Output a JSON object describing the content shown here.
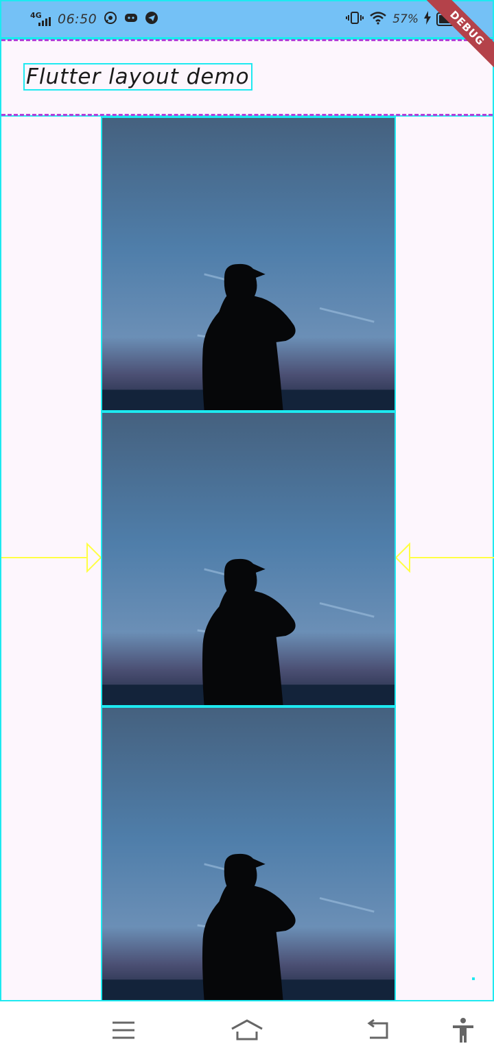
{
  "status_bar": {
    "network": "4G",
    "time": "06:50",
    "battery_percent": "57%",
    "battery_level": 0.57,
    "icons": [
      "whatsapp-icon",
      "discord-icon",
      "telegram-icon",
      "vibrate-icon",
      "wifi-icon",
      "charging-icon"
    ]
  },
  "debug_banner": {
    "label": "DEBUG",
    "color": "#b4424a"
  },
  "app_bar": {
    "title": "Flutter layout demo"
  },
  "main": {
    "images": [
      {
        "alt": "Silhouette of a man in a cap against a blue evening sky over the sea"
      },
      {
        "alt": "Silhouette of a man in a cap against a blue evening sky over the sea"
      },
      {
        "alt": "Silhouette of a man in a cap against a blue evening sky over the sea"
      }
    ]
  },
  "nav_bar": {
    "buttons": [
      "menu-icon",
      "home-icon",
      "back-icon",
      "accessibility-icon"
    ]
  },
  "colors": {
    "debug_outline": "#1de9f0",
    "debug_baseline": "#b33fd8",
    "debug_arrow": "#ffff44",
    "status_bar": "#74c1f6",
    "background": "#fdf6fd"
  }
}
